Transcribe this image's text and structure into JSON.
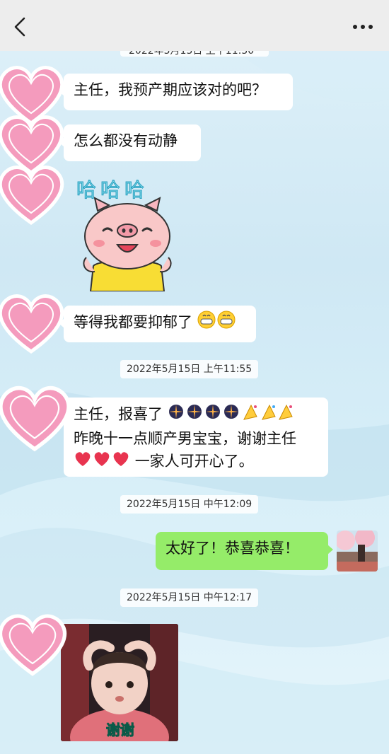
{
  "header": {
    "back_icon": "chevron-left-icon",
    "more_icon": "more-dots-icon"
  },
  "timestamps": {
    "cut_top": "2022年5月15日 上午11:50",
    "t1": "2022年5月15日 上午11:55",
    "t2": "2022年5月15日 中午12:09",
    "t3": "2022年5月15日 中午12:17"
  },
  "messages": {
    "m1": "主任，我预产期应该对的吧？",
    "m2": "怎么都没有动静",
    "sticker_text": "哈哈哈",
    "m3": "等得我都要抑郁了",
    "m4_line1": "主任，报喜了",
    "m4_line2": "昨晚十一点顺产男宝宝，谢谢主任",
    "m4_line3": "一家人可开心了。",
    "m5": "太好了！恭喜恭喜！",
    "photo_caption": "谢谢"
  },
  "colors": {
    "green_bubble": "#95ec69",
    "heart_pink": "#f49bbd",
    "topbar": "#ededed"
  }
}
